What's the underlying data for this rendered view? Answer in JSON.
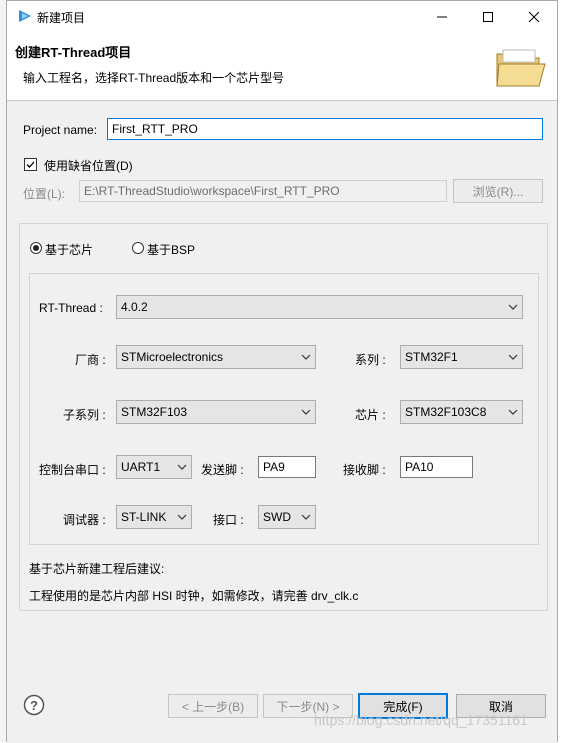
{
  "window": {
    "title": "新建项目",
    "header_title": "创建RT-Thread项目",
    "header_subtitle": "输入工程名，选择RT-Thread版本和一个芯片型号"
  },
  "project": {
    "name_label": "Project name:",
    "name_value": "First_RTT_PRO",
    "use_default_label": "使用缺省位置(D)",
    "use_default_checked": true,
    "location_label": "位置(L):",
    "location_value": "E:\\RT-ThreadStudio\\workspace\\First_RTT_PRO",
    "browse_label": "浏览(R)..."
  },
  "mode": {
    "chip_label": "基于芯片",
    "bsp_label": "基于BSP",
    "selected": "chip"
  },
  "chip": {
    "rtthread_label": "RT-Thread :",
    "rtthread_value": "4.0.2",
    "vendor_label": "厂商 :",
    "vendor_value": "STMicroelectronics",
    "series_label": "系列 :",
    "series_value": "STM32F1",
    "subseries_label": "子系列 :",
    "subseries_value": "STM32F103",
    "chip_label": "芯片 :",
    "chip_value": "STM32F103C8",
    "console_label": "控制台串口 :",
    "console_value": "UART1",
    "tx_label": "发送脚 :",
    "tx_value": "PA9",
    "rx_label": "接收脚 :",
    "rx_value": "PA10",
    "debugger_label": "调试器 :",
    "debugger_value": "ST-LINK",
    "interface_label": "接口 :",
    "interface_value": "SWD"
  },
  "advice": {
    "title": "基于芯片新建工程后建议:",
    "text": "工程使用的是芯片内部 HSI 时钟，如需修改，请完善 drv_clk.c"
  },
  "buttons": {
    "back": "< 上一步(B)",
    "next": "下一步(N) >",
    "finish": "完成(F)",
    "cancel": "取消"
  },
  "watermark": "https://blog.csdn.net/qq_17351161",
  "colors": {
    "accent": "#0078d7",
    "dialog_bg": "#f0f0f0"
  }
}
